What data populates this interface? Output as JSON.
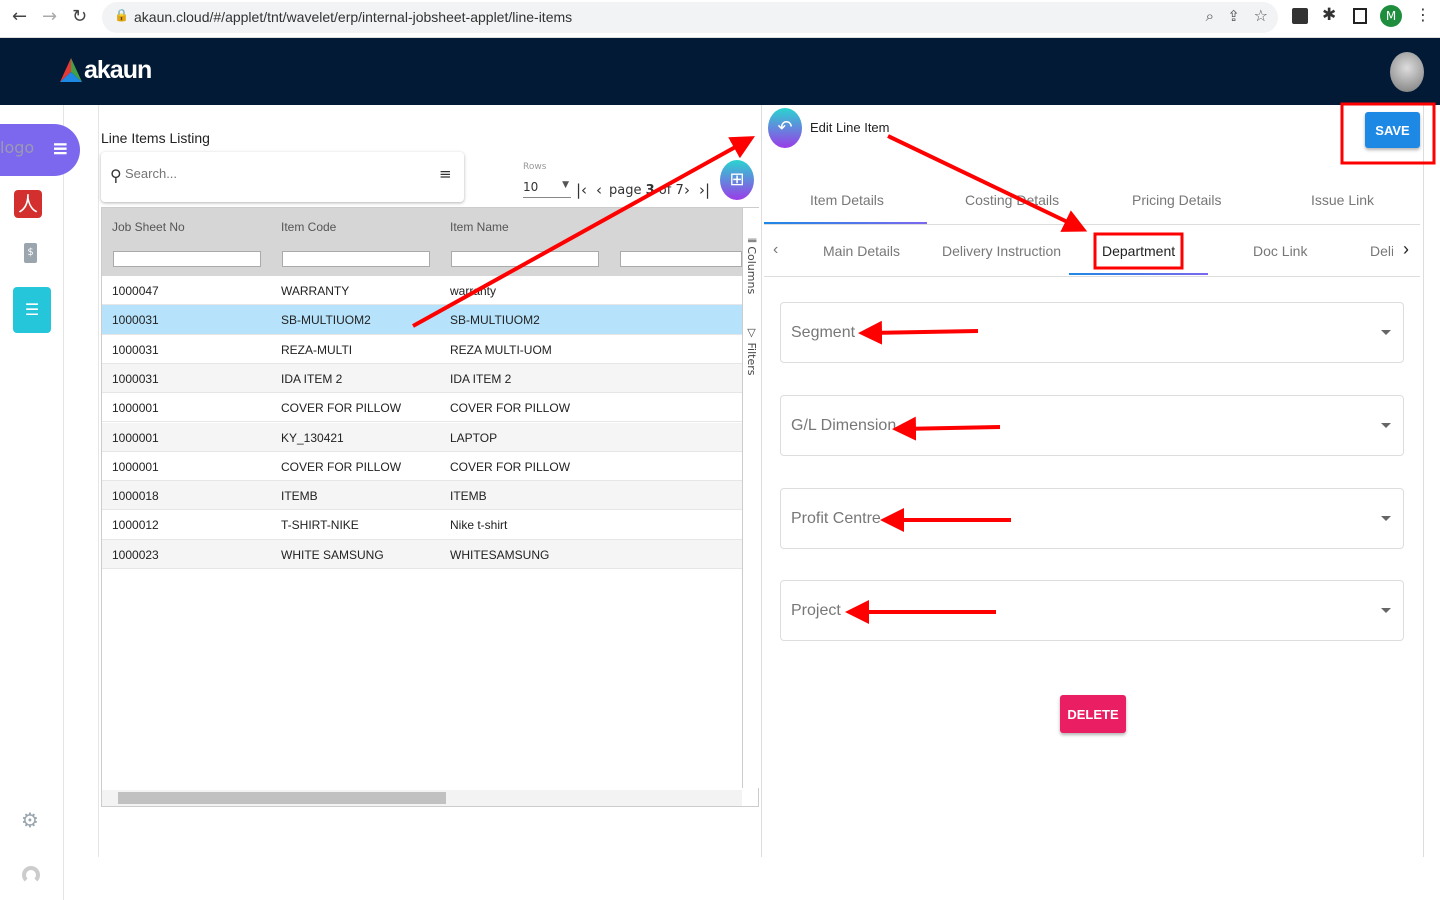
{
  "browser": {
    "url": "akaun.cloud/#/applet/tnt/wavelet/erp/internal-jobsheet-applet/line-items",
    "profile_initial": "M"
  },
  "header": {
    "logo_text": "akaun"
  },
  "sidebar": {
    "logo_alt": "logo",
    "items": [
      {
        "icon": "pdf-icon"
      },
      {
        "icon": "invoice-icon"
      },
      {
        "icon": "list-icon",
        "active": true
      }
    ],
    "bottom": [
      {
        "icon": "gear-icon"
      },
      {
        "icon": "user-icon"
      }
    ]
  },
  "listing": {
    "title": "Line Items Listing",
    "search_placeholder": "Search...",
    "rows_label": "Rows",
    "rows_value": "10",
    "page_text": "page",
    "page_current": "3",
    "page_of": "of",
    "page_total": "7",
    "columns": [
      "Job Sheet No",
      "Item Code",
      "Item Name"
    ],
    "side_tools": [
      "Columns",
      "Filters"
    ],
    "rows": [
      [
        "1000047",
        "WARRANTY",
        "warranty"
      ],
      [
        "1000031",
        "SB-MULTIUOM2",
        "SB-MULTIUOM2"
      ],
      [
        "1000031",
        "REZA-MULTI",
        "REZA MULTI-UOM"
      ],
      [
        "1000031",
        "IDA ITEM 2",
        "IDA ITEM 2"
      ],
      [
        "1000001",
        "COVER FOR PILLOW",
        "COVER FOR PILLOW"
      ],
      [
        "1000001",
        "KY_130421",
        "LAPTOP"
      ],
      [
        "1000001",
        "COVER FOR PILLOW",
        "COVER FOR PILLOW"
      ],
      [
        "1000018",
        "ITEMB",
        "ITEMB"
      ],
      [
        "1000012",
        "T-SHIRT-NIKE",
        "Nike t-shirt"
      ],
      [
        "1000023",
        "WHITE SAMSUNG",
        "WHITESAMSUNG"
      ]
    ],
    "selected_row": 1
  },
  "editor": {
    "title": "Edit Line Item",
    "save_label": "SAVE",
    "delete_label": "DELETE",
    "tabs": [
      "Item Details",
      "Costing Details",
      "Pricing Details",
      "Issue Link"
    ],
    "active_tab": 0,
    "subtabs": [
      "Main Details",
      "Delivery Instruction",
      "Department",
      "Doc Link",
      "Deli"
    ],
    "active_subtab": 2,
    "fields": [
      "Segment",
      "G/L Dimension",
      "Profit Centre",
      "Project"
    ]
  },
  "colors": {
    "header": "#021a35",
    "accent": "#1e88e5",
    "delete": "#e91e63",
    "annotation": "#ff0000",
    "sidebar_menu": "#7b68ee",
    "active_side": "#26c6da"
  }
}
